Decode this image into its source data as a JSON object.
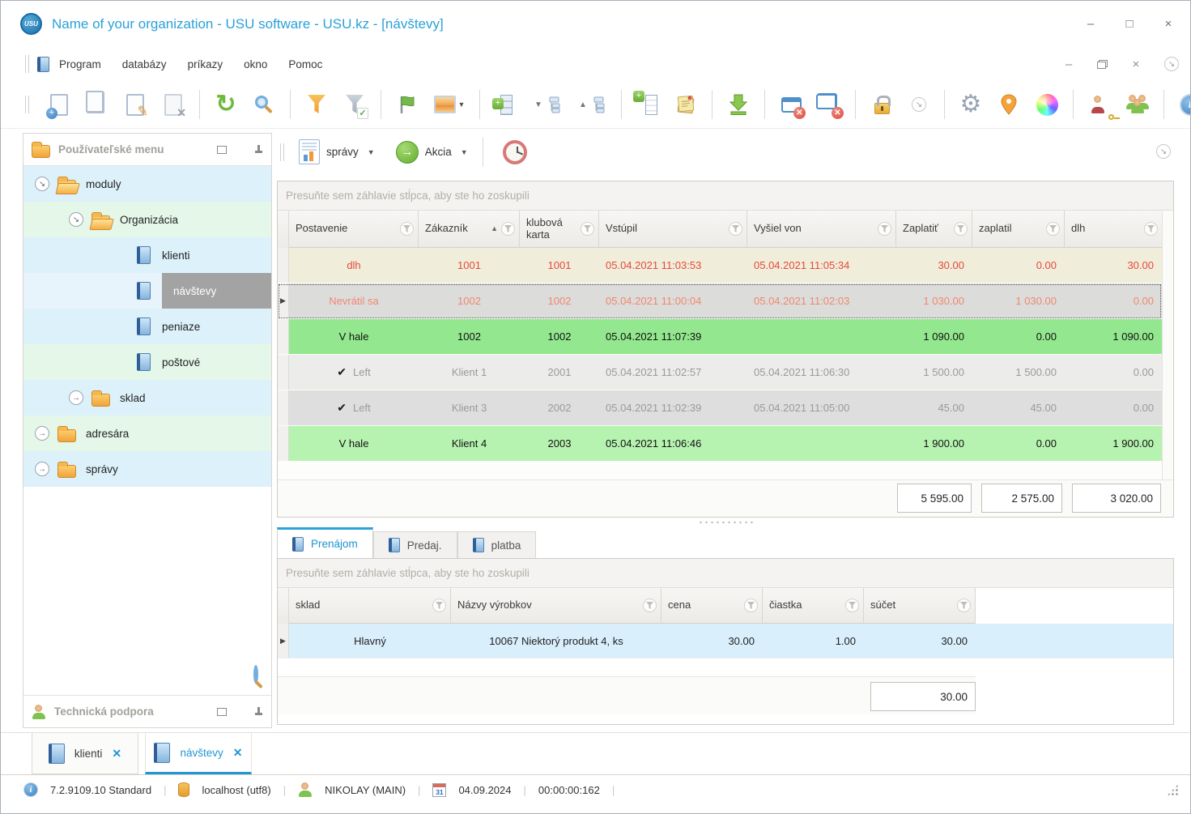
{
  "window": {
    "title": "Name of your organization - USU software - USU.kz - [návštevy]",
    "logo": "USU"
  },
  "menu": {
    "items": [
      "Program",
      "databázy",
      "príkazy",
      "okno",
      "Pomoc"
    ]
  },
  "toolbar": {
    "icons": [
      "add-record",
      "copy-record",
      "edit-record",
      "delete-record",
      "refresh",
      "search",
      "filter",
      "filter-apply",
      "flag",
      "image",
      "expand-levels",
      "collapse-tree",
      "expand-tree",
      "add-row",
      "notes",
      "export",
      "close-window",
      "close-all-windows",
      "lock",
      "overflow-chevron",
      "settings-gear",
      "location-pin",
      "color-wheel",
      "user-permissions",
      "users-group",
      "info",
      "overflow-chevron"
    ]
  },
  "actionbar": {
    "reports_label": "správy",
    "action_label": "Akcia"
  },
  "sidebar": {
    "header": "Používateľské menu",
    "support_header": "Technická podpora",
    "tree": [
      {
        "label": "moduly"
      },
      {
        "label": "Organizácia"
      },
      {
        "label": "klienti"
      },
      {
        "label": "návštevy"
      },
      {
        "label": "peniaze"
      },
      {
        "label": "poštové"
      },
      {
        "label": "sklad"
      },
      {
        "label": "adresára"
      },
      {
        "label": "správy"
      }
    ]
  },
  "main_grid": {
    "groupby_hint": "Presuňte sem záhlavie stĺpca, aby ste ho zoskupili",
    "columns": [
      "Postavenie",
      "Zákazník",
      "klubová karta",
      "Vstúpil",
      "Vyšiel von",
      "Zaplatiť",
      "zaplatil",
      "dlh"
    ],
    "sorted_column": "Zákazník",
    "rows": [
      {
        "checked": false,
        "cells": [
          "dlh",
          "1001",
          "1001",
          "05.04.2021 11:03:53",
          "05.04.2021 11:05:34",
          "30.00",
          "0.00",
          "30.00"
        ]
      },
      {
        "checked": false,
        "cells": [
          "Nevrátil sa",
          "1002",
          "1002",
          "05.04.2021 11:00:04",
          "05.04.2021 11:02:03",
          "1 030.00",
          "1 030.00",
          "0.00"
        ]
      },
      {
        "checked": false,
        "cells": [
          "V hale",
          "1002",
          "1002",
          "05.04.2021 11:07:39",
          "",
          "1 090.00",
          "0.00",
          "1 090.00"
        ]
      },
      {
        "checked": true,
        "cells": [
          "Left",
          "Klient 1",
          "2001",
          "05.04.2021 11:02:57",
          "05.04.2021 11:06:30",
          "1 500.00",
          "1 500.00",
          "0.00"
        ]
      },
      {
        "checked": true,
        "cells": [
          "Left",
          "Klient 3",
          "2002",
          "05.04.2021 11:02:39",
          "05.04.2021 11:05:00",
          "45.00",
          "45.00",
          "0.00"
        ]
      },
      {
        "checked": false,
        "cells": [
          "V hale",
          "Klient 4",
          "2003",
          "05.04.2021 11:06:46",
          "",
          "1 900.00",
          "0.00",
          "1 900.00"
        ]
      }
    ],
    "totals": {
      "zaplatit": "5 595.00",
      "zaplatil": "2 575.00",
      "dlh": "3 020.00"
    }
  },
  "detail": {
    "tabs": [
      "Prenájom",
      "Predaj.",
      "platba"
    ],
    "active_tab": "Prenájom",
    "groupby_hint": "Presuňte sem záhlavie stĺpca, aby ste ho zoskupili",
    "columns": [
      "sklad",
      "Názvy výrobkov",
      "cena",
      "čiastka",
      "súčet"
    ],
    "rows": [
      {
        "cells": [
          "Hlavný",
          "10067 Niektorý produkt 4, ks",
          "30.00",
          "1.00",
          "30.00"
        ]
      }
    ],
    "total": "30.00"
  },
  "doc_tabs": [
    {
      "label": "klienti",
      "active": false
    },
    {
      "label": "návštevy",
      "active": true
    }
  ],
  "statusbar": {
    "version": "7.2.9109.10 Standard",
    "database": "localhost (utf8)",
    "user": "NIKOLAY (MAIN)",
    "calendar_day": "31",
    "date": "04.09.2024",
    "timer": "00:00:00:162"
  }
}
